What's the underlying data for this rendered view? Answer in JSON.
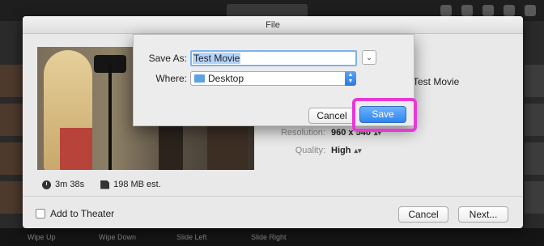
{
  "sheet": {
    "title": "File",
    "movie_title": "Test Movie",
    "duration": "3m 38s",
    "size": "198 MB est.",
    "resolution_label": "Resolution:",
    "resolution_value": "960 x 540",
    "quality_label": "Quality:",
    "quality_value": "High",
    "add_to_theater": "Add to Theater",
    "cancel": "Cancel",
    "next": "Next..."
  },
  "save_dialog": {
    "save_as_label": "Save As:",
    "save_as_value": "Test Movie",
    "where_label": "Where:",
    "where_value": "Desktop",
    "cancel": "Cancel",
    "save": "Save"
  },
  "bottom_bar": {
    "items": [
      "Wipe Up",
      "Wipe Down",
      "Slide Left",
      "Slide Right"
    ]
  },
  "colors": {
    "save_button": "#2d86f0",
    "highlight": "#e838d6"
  }
}
